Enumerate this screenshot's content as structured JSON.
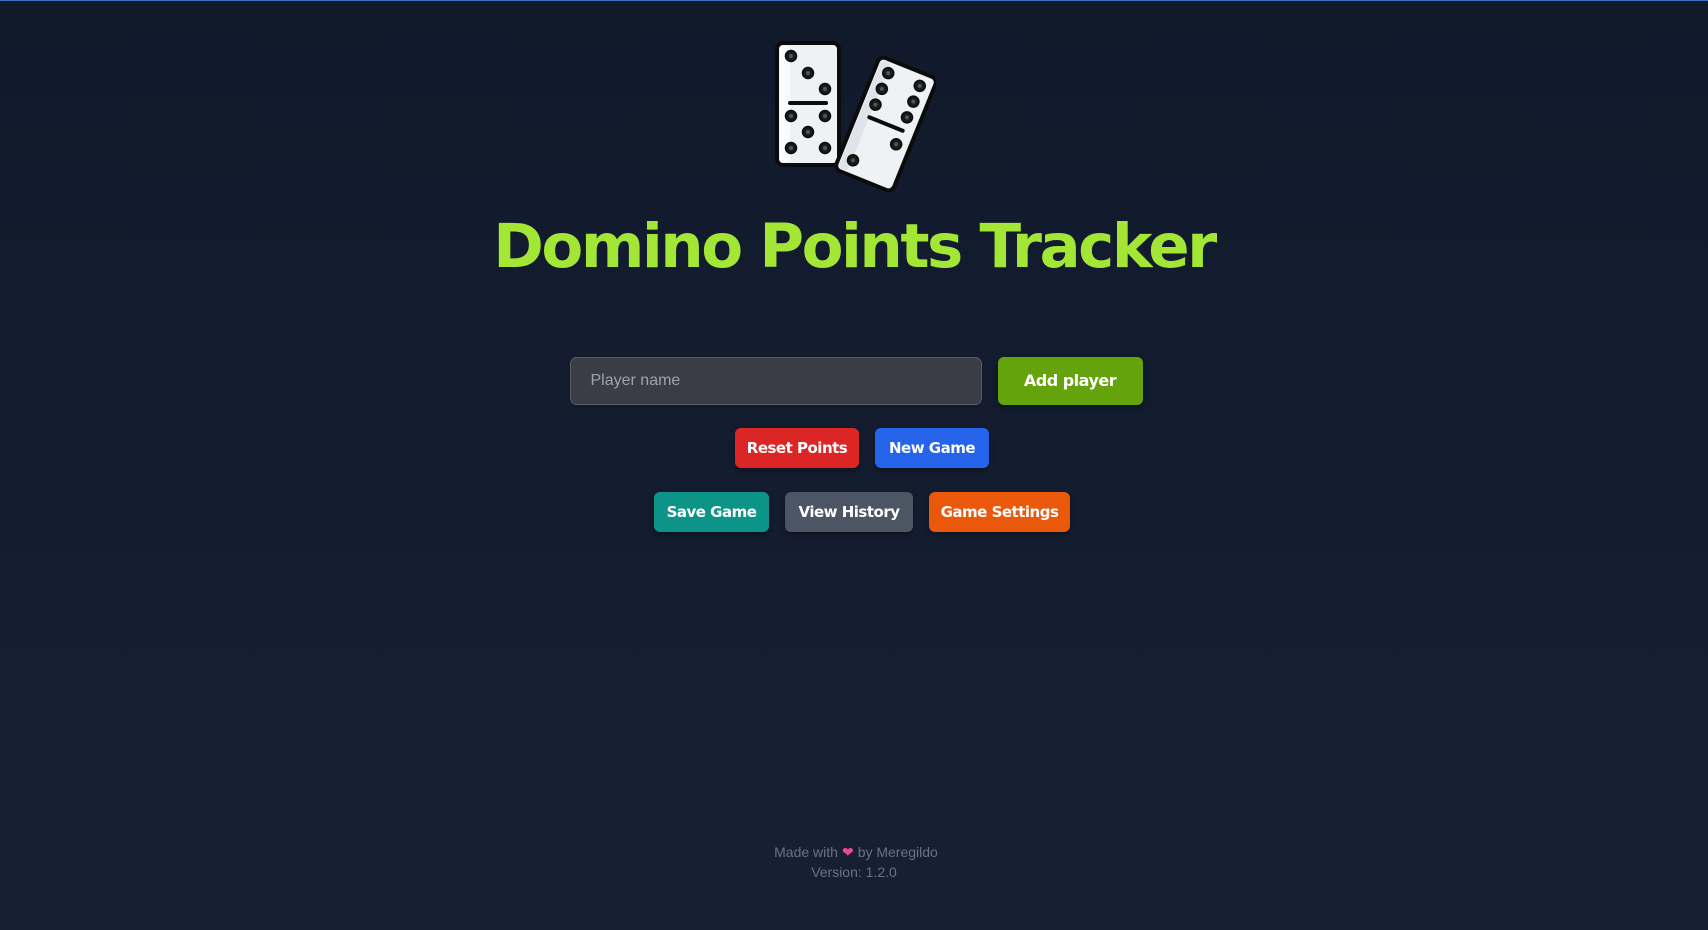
{
  "app": {
    "title": "Domino Points Tracker",
    "logo_icon": "dominoes-icon"
  },
  "add_player": {
    "placeholder": "Player name",
    "value": "",
    "button_label": "Add player"
  },
  "actions": {
    "reset_label": "Reset Points",
    "new_game_label": "New Game",
    "save_label": "Save Game",
    "history_label": "View History",
    "settings_label": "Game Settings"
  },
  "footer": {
    "made_with": "Made with",
    "heart_icon": "heart-icon",
    "heart_glyph": "❤",
    "by": "by Meregildo",
    "version": "Version: 1.2.0"
  },
  "colors": {
    "title": "#a3e635",
    "add": "#65a30d",
    "reset": "#dc2626",
    "new_game": "#2563eb",
    "save": "#0d9488",
    "history": "#4b5563",
    "settings": "#ea580c",
    "heart": "#ec4899"
  }
}
